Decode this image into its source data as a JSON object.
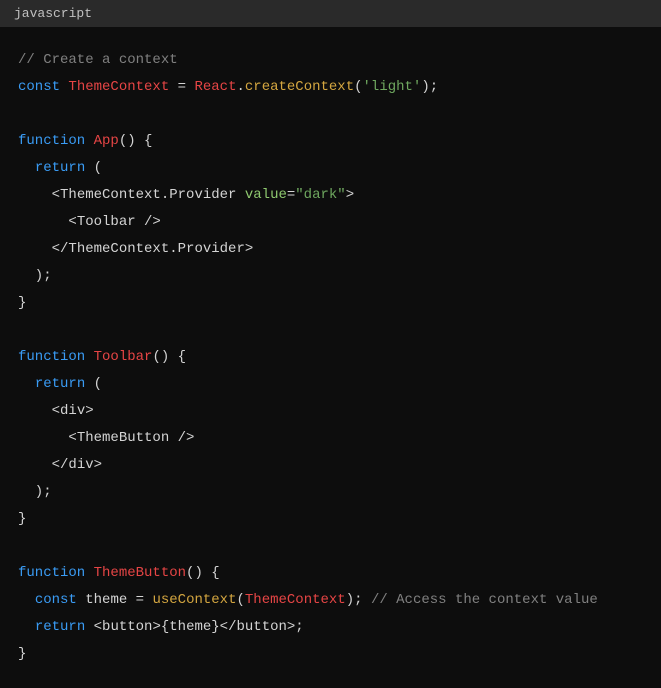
{
  "tab": {
    "label": "javascript"
  },
  "code": {
    "tokens": [
      [
        {
          "cls": "comment",
          "t": "// Create a context"
        }
      ],
      [
        {
          "cls": "keyword",
          "t": "const "
        },
        {
          "cls": "classname",
          "t": "ThemeContext"
        },
        {
          "cls": "punct",
          "t": " = "
        },
        {
          "cls": "classname",
          "t": "React"
        },
        {
          "cls": "punct",
          "t": "."
        },
        {
          "cls": "method",
          "t": "createContext"
        },
        {
          "cls": "punct",
          "t": "("
        },
        {
          "cls": "string",
          "t": "'light'"
        },
        {
          "cls": "punct",
          "t": ");"
        }
      ],
      [],
      [
        {
          "cls": "keyword",
          "t": "function "
        },
        {
          "cls": "classname",
          "t": "App"
        },
        {
          "cls": "punct",
          "t": "() {"
        }
      ],
      [
        {
          "cls": "punct",
          "t": "  "
        },
        {
          "cls": "keyword",
          "t": "return"
        },
        {
          "cls": "punct",
          "t": " ("
        }
      ],
      [
        {
          "cls": "punct",
          "t": "    <"
        },
        {
          "cls": "tagname",
          "t": "ThemeContext.Provider"
        },
        {
          "cls": "punct",
          "t": " "
        },
        {
          "cls": "attr",
          "t": "value"
        },
        {
          "cls": "punct",
          "t": "="
        },
        {
          "cls": "string",
          "t": "\"dark\""
        },
        {
          "cls": "punct",
          "t": ">"
        }
      ],
      [
        {
          "cls": "punct",
          "t": "      <"
        },
        {
          "cls": "tagname",
          "t": "Toolbar"
        },
        {
          "cls": "punct",
          "t": " />"
        }
      ],
      [
        {
          "cls": "punct",
          "t": "    </"
        },
        {
          "cls": "tagname",
          "t": "ThemeContext.Provider"
        },
        {
          "cls": "punct",
          "t": ">"
        }
      ],
      [
        {
          "cls": "punct",
          "t": "  );"
        }
      ],
      [
        {
          "cls": "punct",
          "t": "}"
        }
      ],
      [],
      [
        {
          "cls": "keyword",
          "t": "function "
        },
        {
          "cls": "classname",
          "t": "Toolbar"
        },
        {
          "cls": "punct",
          "t": "() {"
        }
      ],
      [
        {
          "cls": "punct",
          "t": "  "
        },
        {
          "cls": "keyword",
          "t": "return"
        },
        {
          "cls": "punct",
          "t": " ("
        }
      ],
      [
        {
          "cls": "punct",
          "t": "    <"
        },
        {
          "cls": "tagname",
          "t": "div"
        },
        {
          "cls": "punct",
          "t": ">"
        }
      ],
      [
        {
          "cls": "punct",
          "t": "      <"
        },
        {
          "cls": "tagname",
          "t": "ThemeButton"
        },
        {
          "cls": "punct",
          "t": " />"
        }
      ],
      [
        {
          "cls": "punct",
          "t": "    </"
        },
        {
          "cls": "tagname",
          "t": "div"
        },
        {
          "cls": "punct",
          "t": ">"
        }
      ],
      [
        {
          "cls": "punct",
          "t": "  );"
        }
      ],
      [
        {
          "cls": "punct",
          "t": "}"
        }
      ],
      [],
      [
        {
          "cls": "keyword",
          "t": "function "
        },
        {
          "cls": "classname",
          "t": "ThemeButton"
        },
        {
          "cls": "punct",
          "t": "() {"
        }
      ],
      [
        {
          "cls": "punct",
          "t": "  "
        },
        {
          "cls": "keyword",
          "t": "const"
        },
        {
          "cls": "punct",
          "t": " "
        },
        {
          "cls": "entity",
          "t": "theme"
        },
        {
          "cls": "punct",
          "t": " = "
        },
        {
          "cls": "method",
          "t": "useContext"
        },
        {
          "cls": "punct",
          "t": "("
        },
        {
          "cls": "classname",
          "t": "ThemeContext"
        },
        {
          "cls": "punct",
          "t": "); "
        },
        {
          "cls": "comment",
          "t": "// Access the context value"
        }
      ],
      [
        {
          "cls": "punct",
          "t": "  "
        },
        {
          "cls": "keyword",
          "t": "return"
        },
        {
          "cls": "punct",
          "t": " <"
        },
        {
          "cls": "tagname",
          "t": "button"
        },
        {
          "cls": "punct",
          "t": ">{theme}</"
        },
        {
          "cls": "tagname",
          "t": "button"
        },
        {
          "cls": "punct",
          "t": ">;"
        }
      ],
      [
        {
          "cls": "punct",
          "t": "}"
        }
      ]
    ]
  }
}
